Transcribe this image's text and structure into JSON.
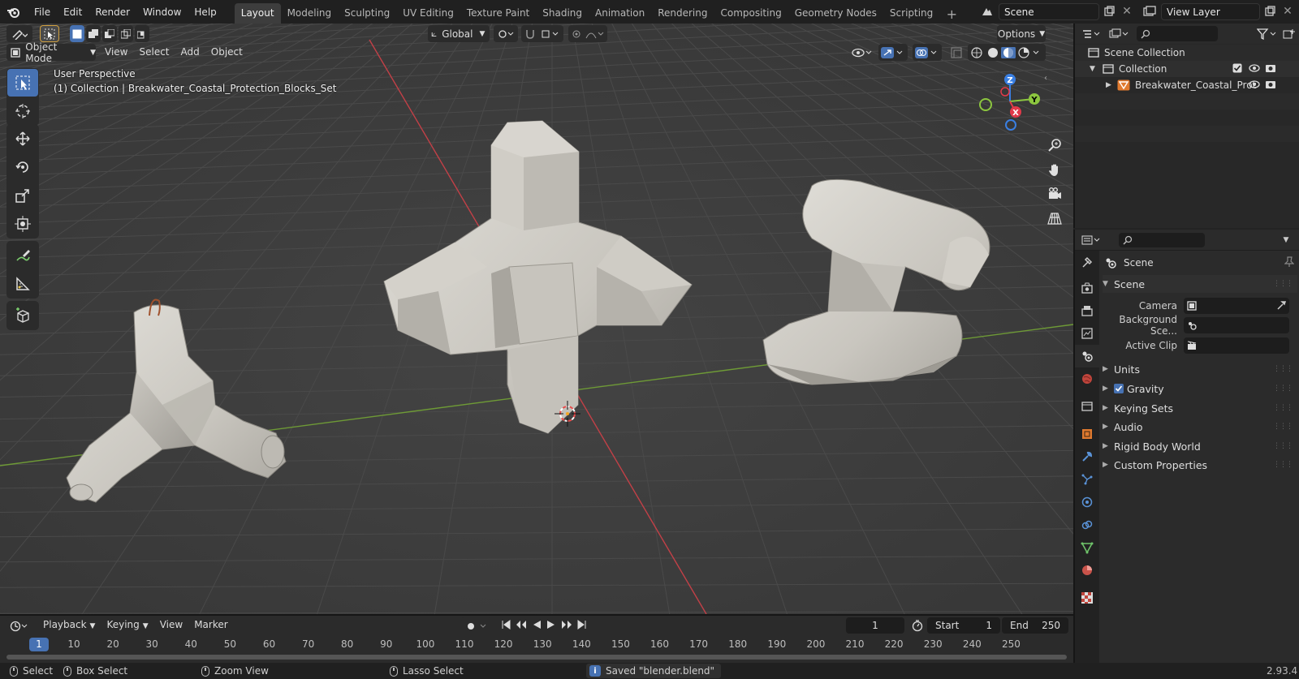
{
  "menubar": {
    "items": [
      "File",
      "Edit",
      "Render",
      "Window",
      "Help"
    ]
  },
  "workspaces": {
    "tabs": [
      "Layout",
      "Modeling",
      "Sculpting",
      "UV Editing",
      "Texture Paint",
      "Shading",
      "Animation",
      "Rendering",
      "Compositing",
      "Geometry Nodes",
      "Scripting"
    ],
    "active_index": 0
  },
  "scene_selector": {
    "value": "Scene"
  },
  "view_layer_selector": {
    "value": "View Layer"
  },
  "viewport": {
    "transform_orientation": "Global",
    "options_label": "Options",
    "mode_label": "Object Mode",
    "header_menus": [
      "View",
      "Select",
      "Add",
      "Object"
    ],
    "perspective_label": "User Perspective",
    "collection_info": "(1) Collection | Breakwater_Coastal_Protection_Blocks_Set",
    "gizmo": {
      "x": "X",
      "y": "Y",
      "z": "Z"
    }
  },
  "outliner": {
    "scene_collection": "Scene Collection",
    "collection": "Collection",
    "object": "Breakwater_Coastal_Prot"
  },
  "properties": {
    "header_title": "Scene",
    "panel_title": "Scene",
    "camera_label": "Camera",
    "background_label": "Background Sce...",
    "active_clip_label": "Active Clip",
    "sections": [
      "Units",
      "Gravity",
      "Keying Sets",
      "Audio",
      "Rigid Body World",
      "Custom Properties"
    ],
    "gravity_checked": true
  },
  "timeline": {
    "menus": [
      "Playback",
      "Keying",
      "View",
      "Marker"
    ],
    "current_frame": "1",
    "start_label": "Start",
    "start_value": "1",
    "end_label": "End",
    "end_value": "250",
    "ruler_ticks": [
      "10",
      "20",
      "30",
      "40",
      "50",
      "60",
      "70",
      "80",
      "90",
      "100",
      "110",
      "120",
      "130",
      "140",
      "150",
      "160",
      "170",
      "180",
      "190",
      "200",
      "210",
      "220",
      "230",
      "240",
      "250"
    ],
    "ruler_current": "1"
  },
  "statusbar": {
    "select": "Select",
    "box_select": "Box Select",
    "zoom_view": "Zoom View",
    "lasso_select": "Lasso Select",
    "message": "Saved \"blender.blend\"",
    "version": "2.93.4"
  },
  "colors": {
    "accent": "#4772b3",
    "x_axis": "#e23a4a",
    "y_axis": "#8cc63f",
    "z_axis": "#3a7fe2",
    "viewport_bg": "#3d3d3d"
  }
}
